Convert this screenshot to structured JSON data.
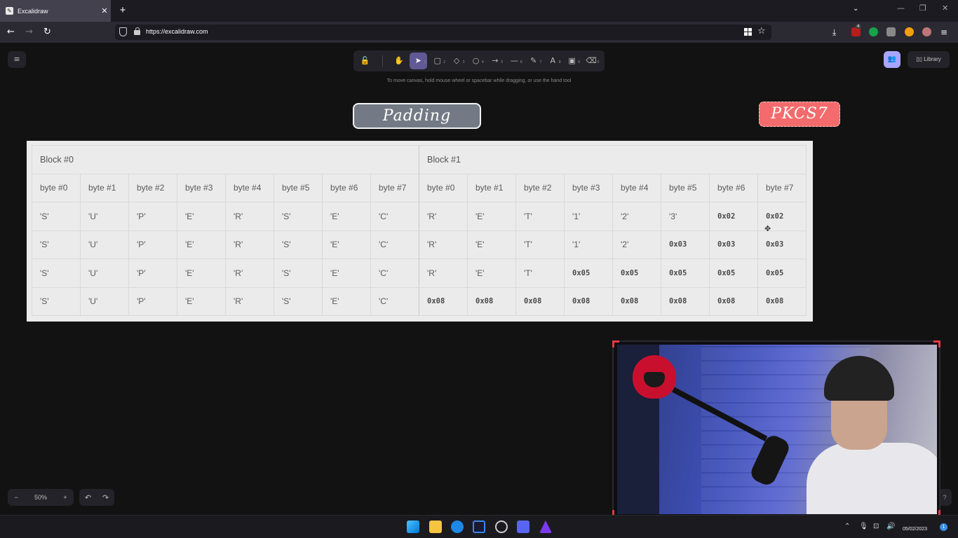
{
  "browser": {
    "tab_title": "Excalidraw",
    "tab_close": "✕",
    "new_tab": "+",
    "url": "https://excalidraw.com",
    "window_controls": [
      "—",
      "❐",
      "✕"
    ],
    "extension_badge": "4"
  },
  "excalidraw": {
    "menu_icon": "≡",
    "tools": [
      {
        "name": "lock-tool",
        "glyph": "🔓",
        "num": ""
      },
      {
        "name": "hand-tool",
        "glyph": "✋",
        "num": ""
      },
      {
        "name": "select-tool",
        "glyph": "➤",
        "num": "1"
      },
      {
        "name": "rectangle-tool",
        "glyph": "▢",
        "num": "2"
      },
      {
        "name": "diamond-tool",
        "glyph": "◇",
        "num": "3"
      },
      {
        "name": "ellipse-tool",
        "glyph": "○",
        "num": "4"
      },
      {
        "name": "arrow-tool",
        "glyph": "→",
        "num": "5"
      },
      {
        "name": "line-tool",
        "glyph": "—",
        "num": "6"
      },
      {
        "name": "draw-tool",
        "glyph": "✎",
        "num": "7"
      },
      {
        "name": "text-tool",
        "glyph": "A",
        "num": "8"
      },
      {
        "name": "image-tool",
        "glyph": "▣",
        "num": "9"
      },
      {
        "name": "eraser-tool",
        "glyph": "⌫",
        "num": "0"
      }
    ],
    "hint": "To move canvas, hold mouse wheel or spacebar while dragging, or use the hand tool",
    "library_label": "Library",
    "zoom_level": "50%",
    "zoom_out": "−",
    "zoom_in": "+",
    "undo": "↶",
    "redo": "↷"
  },
  "labels": {
    "padding": "Padding",
    "pkcs": "PKCS7"
  },
  "table": {
    "blocks": [
      "Block #0",
      "Block #1"
    ],
    "headers": [
      "byte #0",
      "byte #1",
      "byte #2",
      "byte #3",
      "byte #4",
      "byte #5",
      "byte #6",
      "byte #7",
      "byte #0",
      "byte #1",
      "byte #2",
      "byte #3",
      "byte #4",
      "byte #5",
      "byte #6",
      "byte #7"
    ],
    "rows": [
      [
        "'S'",
        "'U'",
        "'P'",
        "'E'",
        "'R'",
        "'S'",
        "'E'",
        "'C'",
        "'R'",
        "'E'",
        "'T'",
        "'1'",
        "'2'",
        "'3'",
        "0x02",
        "0x02"
      ],
      [
        "'S'",
        "'U'",
        "'P'",
        "'E'",
        "'R'",
        "'S'",
        "'E'",
        "'C'",
        "'R'",
        "'E'",
        "'T'",
        "'1'",
        "'2'",
        "0x03",
        "0x03",
        "0x03"
      ],
      [
        "'S'",
        "'U'",
        "'P'",
        "'E'",
        "'R'",
        "'S'",
        "'E'",
        "'C'",
        "'R'",
        "'E'",
        "'T'",
        "0x05",
        "0x05",
        "0x05",
        "0x05",
        "0x05"
      ],
      [
        "'S'",
        "'U'",
        "'P'",
        "'E'",
        "'R'",
        "'S'",
        "'E'",
        "'C'",
        "0x08",
        "0x08",
        "0x08",
        "0x08",
        "0x08",
        "0x08",
        "0x08",
        "0x08"
      ]
    ]
  },
  "taskbar": {
    "date": "05/02/2023",
    "notif_count": "1"
  }
}
